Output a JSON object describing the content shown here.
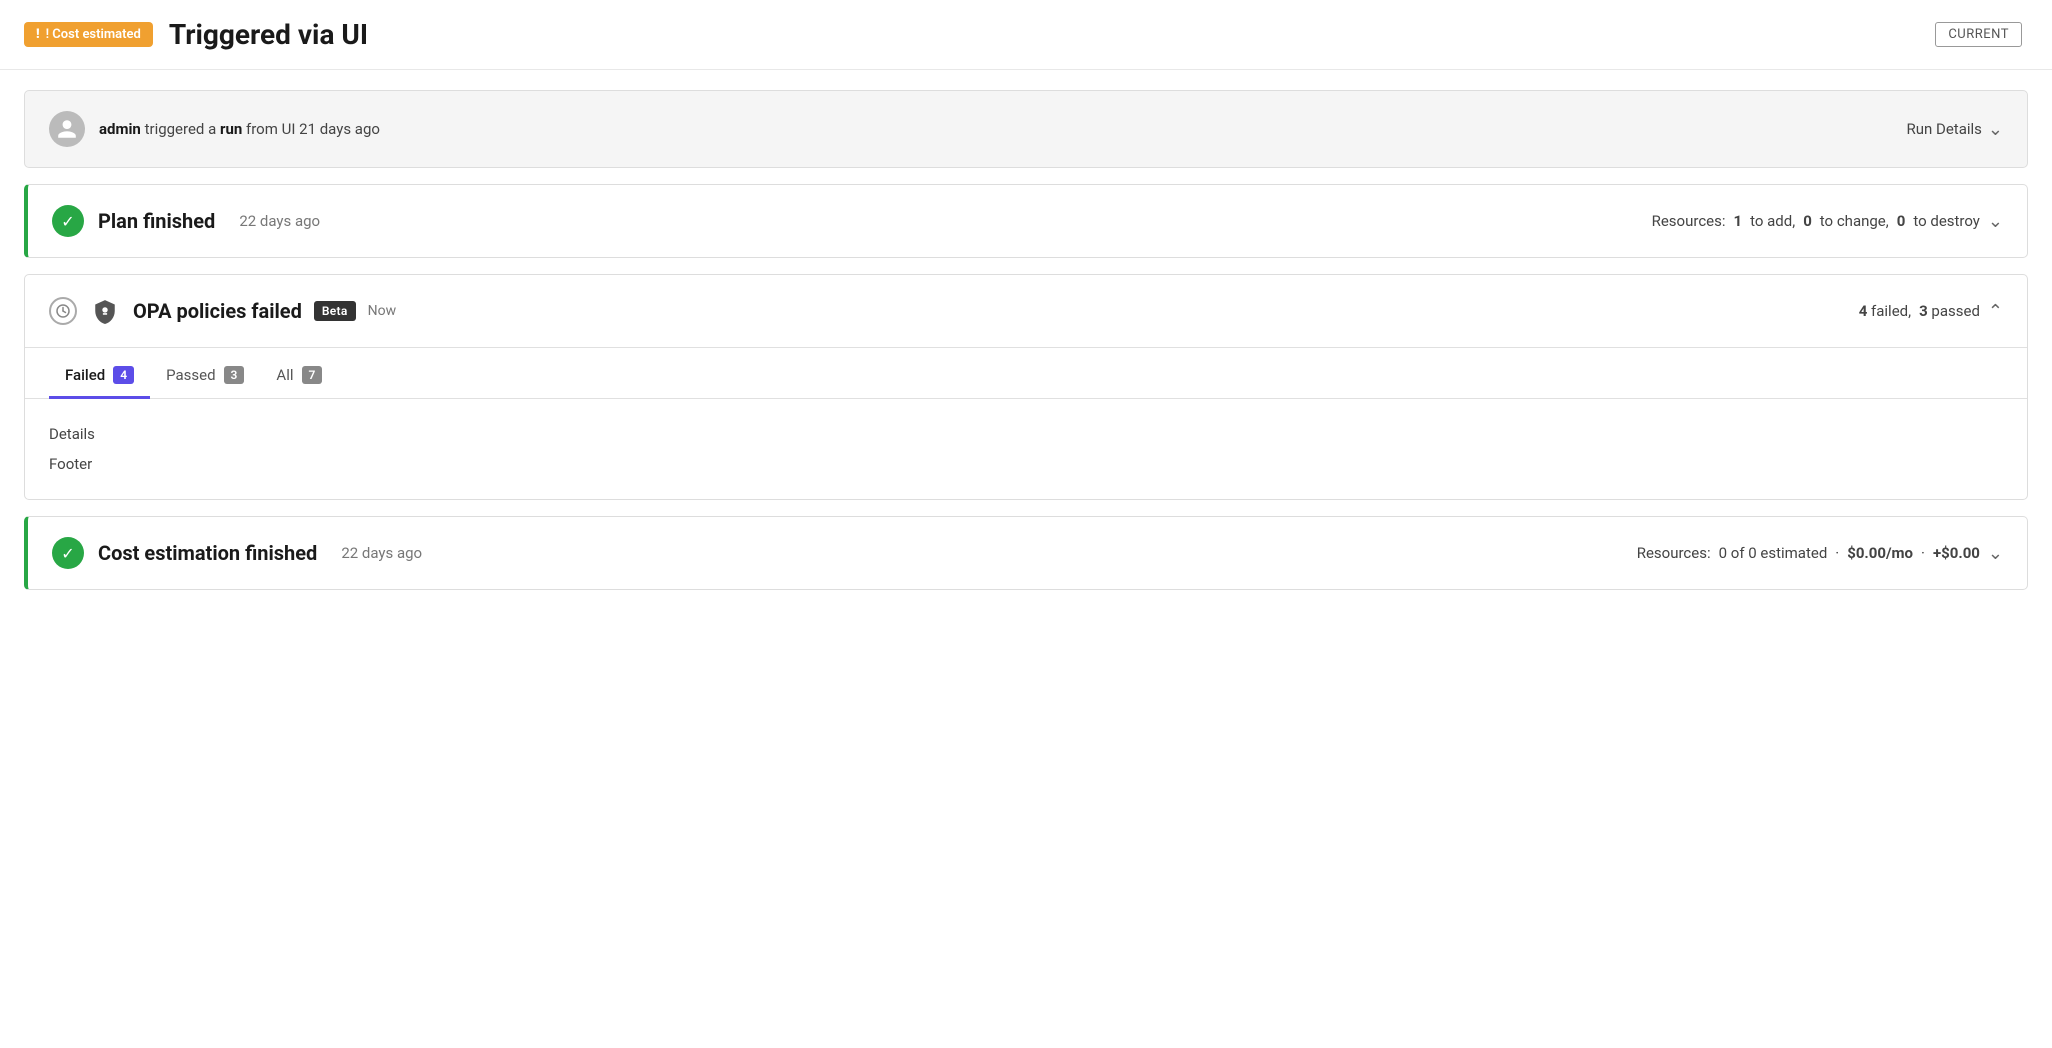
{
  "header": {
    "cost_badge_label": "! Cost estimated",
    "page_title": "Triggered via UI",
    "current_label": "CURRENT"
  },
  "run_info": {
    "user": "admin",
    "action_text": "triggered a",
    "action_bold": "run",
    "action_suffix": "from UI 21 days ago",
    "run_details_label": "Run Details"
  },
  "plan_card": {
    "title": "Plan finished",
    "time": "22 days ago",
    "resources_label": "Resources:",
    "add_count": "1",
    "add_label": "to add,",
    "change_count": "0",
    "change_label": "to change,",
    "destroy_count": "0",
    "destroy_label": "to destroy"
  },
  "opa_card": {
    "title": "OPA policies failed",
    "beta_label": "Beta",
    "time": "Now",
    "failed_count": "4",
    "failed_label": "failed,",
    "passed_count": "3",
    "passed_label": "passed",
    "tabs": [
      {
        "label": "Failed",
        "count": "4",
        "type": "failed",
        "active": true
      },
      {
        "label": "Passed",
        "count": "3",
        "type": "neutral",
        "active": false
      },
      {
        "label": "All",
        "count": "7",
        "type": "neutral",
        "active": false
      }
    ],
    "details_label": "Details",
    "footer_label": "Footer"
  },
  "cost_estimation_card": {
    "title": "Cost estimation finished",
    "time": "22 days ago",
    "resources_label": "Resources:",
    "estimated_text": "0 of 0 estimated",
    "monthly": "$0.00/mo",
    "plus": "+$0.00"
  }
}
